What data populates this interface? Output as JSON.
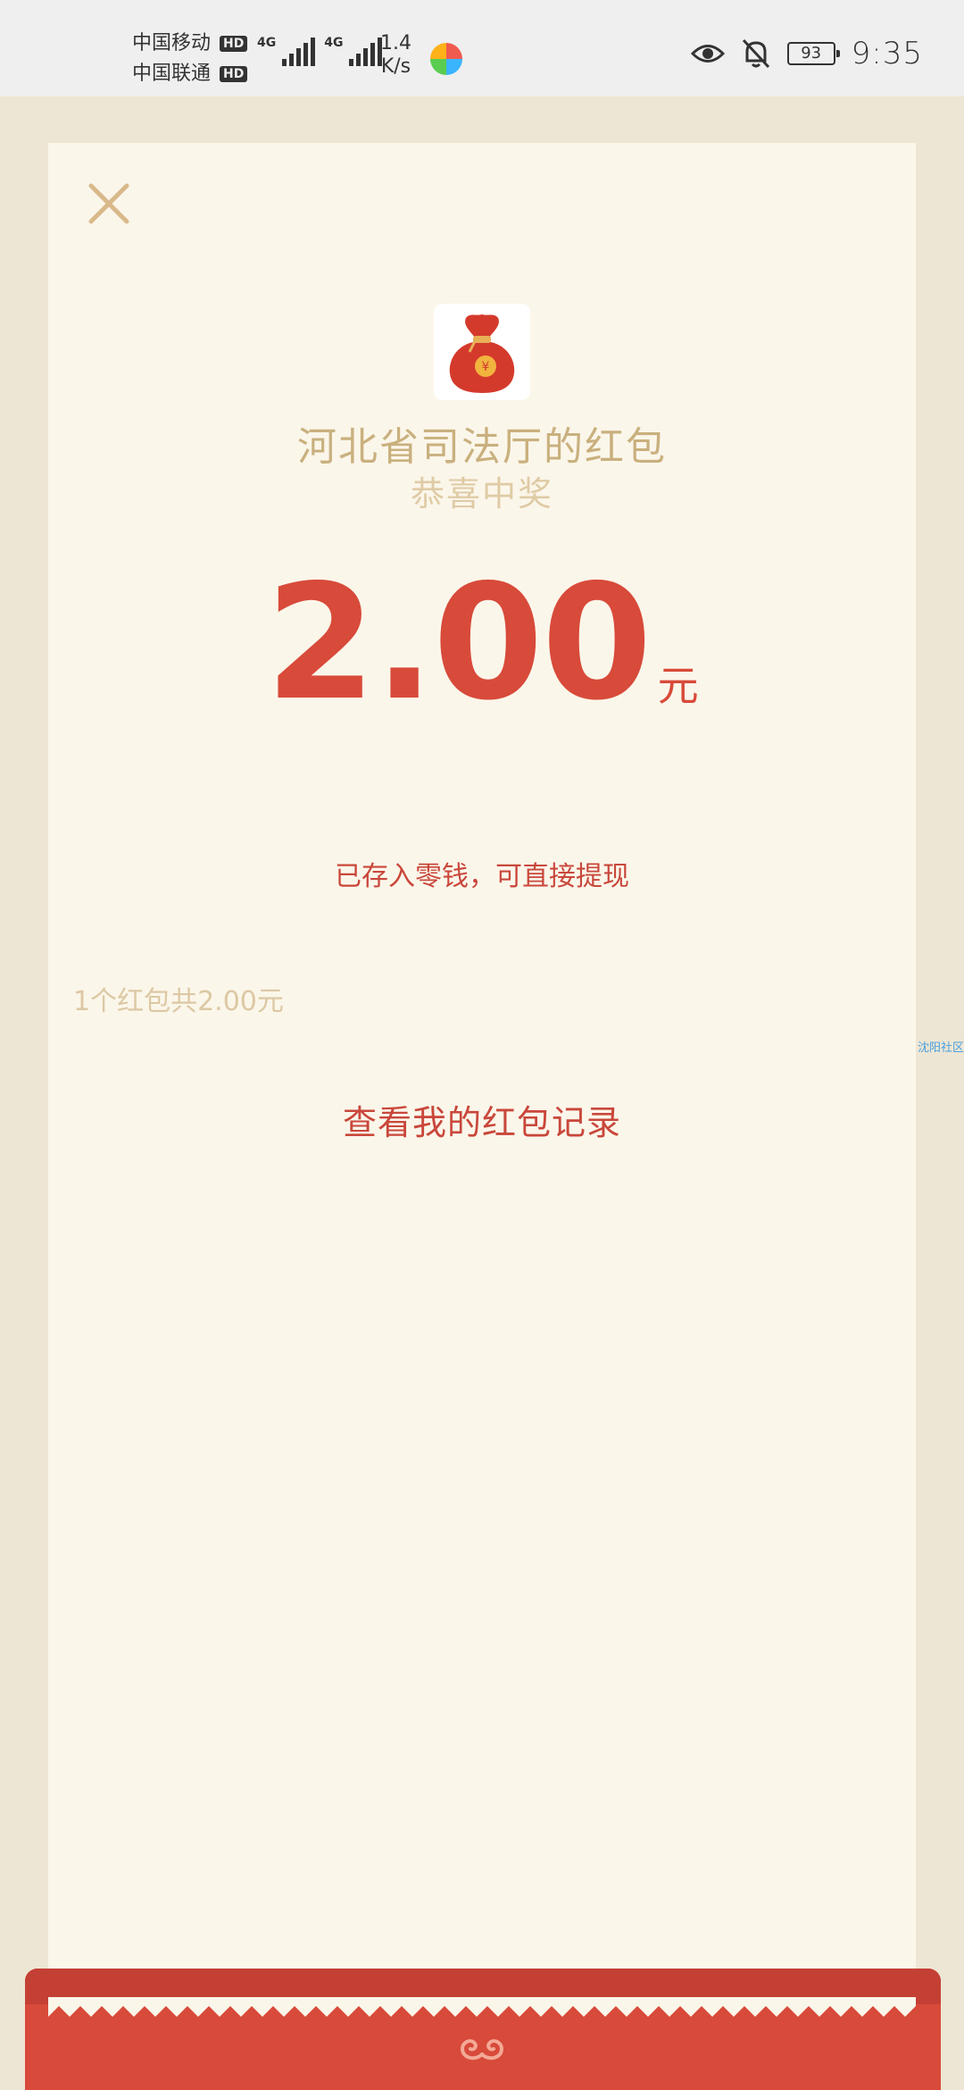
{
  "status_bar": {
    "carrier1": "中国移动",
    "carrier2": "中国联通",
    "hd_label": "HD",
    "sig_tag": "4G",
    "net_speed_value": "1.4",
    "net_speed_unit": "K/s",
    "battery": "93",
    "time": "9:35"
  },
  "icons": {
    "close": "close-icon",
    "bag": "money-bag-icon",
    "eye": "eye-icon",
    "bell_off": "bell-off-icon",
    "swirl": "swirl-icon"
  },
  "colors": {
    "accent_red": "#D84A3A",
    "gold": "#C9B07E",
    "card_bg": "#FBF6EA",
    "page_bg": "#EEE6D4"
  },
  "envelope": {
    "title": "河北省司法厅的红包",
    "subtitle": "恭喜中奖",
    "amount": "2.00",
    "unit": "元",
    "note": "已存入零钱，可直接提现",
    "summary": "1个红包共2.00元",
    "record_link": "查看我的红包记录"
  },
  "watermark": "沈阳社区"
}
